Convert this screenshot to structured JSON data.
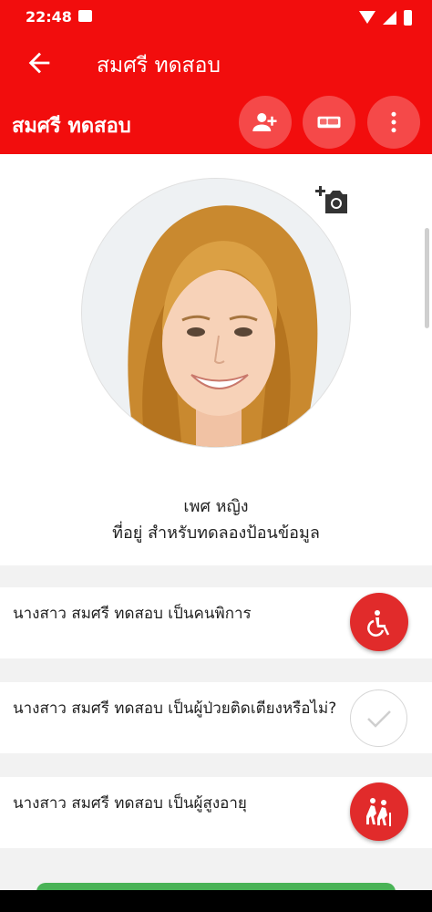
{
  "status_bar": {
    "time": "22:48"
  },
  "app_bar": {
    "title": "สมศรี ทดสอบ"
  },
  "sub_header": {
    "name": "สมศรี ทดสอบ"
  },
  "profile": {
    "gender": "เพศ หญิง",
    "address": "ที่อยู่ สำหรับทดลองป้อนข้อมูล"
  },
  "cards": [
    {
      "text": "นางสาว สมศรี ทดสอบ เป็นคนพิการ",
      "icon": "wheelchair-icon",
      "state": "active"
    },
    {
      "text": "นางสาว สมศรี ทดสอบ เป็นผู้ป่วยติดเตียงหรือไม่?",
      "icon": "check-icon",
      "state": "inactive"
    },
    {
      "text": "นางสาว สมศรี ทดสอบ เป็นผู้สูงอายุ",
      "icon": "elderly-icon",
      "state": "active"
    }
  ],
  "colors": {
    "primary": "#f20d0d",
    "status_active": "#e12b2b",
    "bottom_button": "#49b356"
  }
}
